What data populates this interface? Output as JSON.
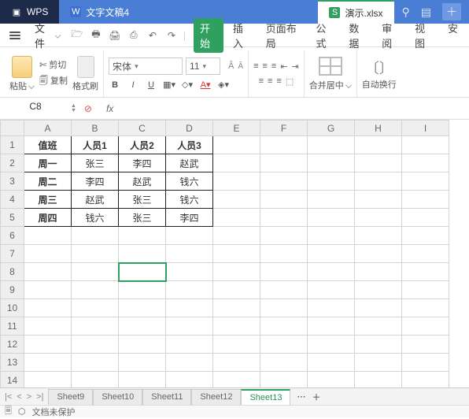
{
  "titlebar": {
    "app": "WPS",
    "docTab": "文字文稿4",
    "xlsxTab": "演示.xlsx"
  },
  "filebtn": "文件",
  "menus": {
    "start": "开始",
    "insert": "插入",
    "pageLayout": "页面布局",
    "formula": "公式",
    "data": "数据",
    "review": "审阅",
    "view": "视图",
    "safety": "安"
  },
  "ribbon": {
    "paste": "粘贴",
    "cut": "剪切",
    "copy": "复制",
    "brush": "格式刷",
    "fontName": "宋体",
    "fontSize": "11",
    "merge": "合并居中",
    "autoWrap": "自动换行"
  },
  "cellRef": "C8",
  "fxLabel": "fx",
  "headers": [
    "A",
    "B",
    "C",
    "D",
    "E",
    "F",
    "G",
    "H",
    "I"
  ],
  "rows": [
    1,
    2,
    3,
    4,
    5,
    6,
    7,
    8,
    9,
    10,
    11,
    12,
    13,
    14
  ],
  "table": {
    "head": [
      "值班",
      "人员1",
      "人员2",
      "人员3"
    ],
    "body": [
      [
        "周一",
        "张三",
        "李四",
        "赵武"
      ],
      [
        "周二",
        "李四",
        "赵武",
        "钱六"
      ],
      [
        "周三",
        "赵武",
        "张三",
        "钱六"
      ],
      [
        "周四",
        "钱六",
        "张三",
        "李四"
      ]
    ]
  },
  "sheets": [
    "Sheet9",
    "Sheet10",
    "Sheet11",
    "Sheet12",
    "Sheet13"
  ],
  "activeSheet": "Sheet13",
  "status": "文档未保护",
  "activeCell": {
    "row": 8,
    "col": "C"
  }
}
